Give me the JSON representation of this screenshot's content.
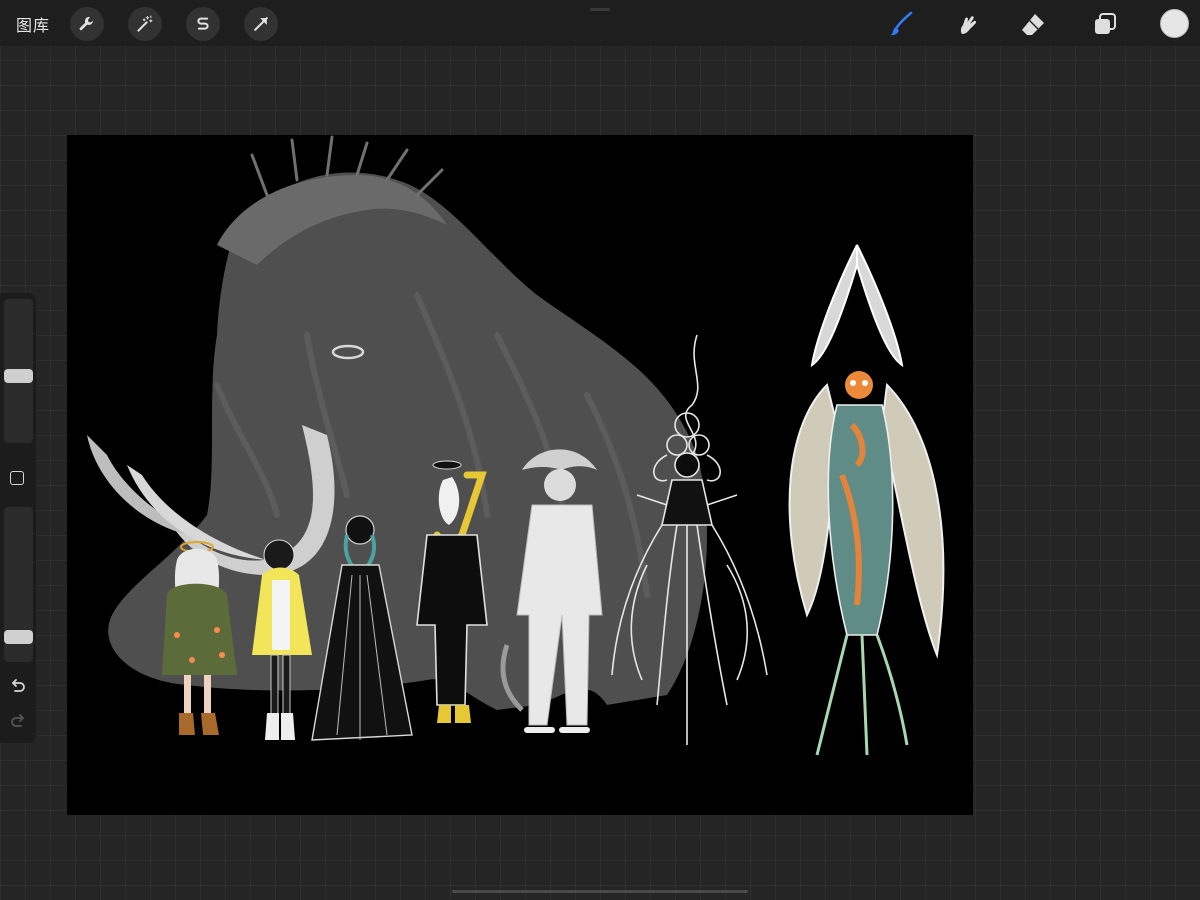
{
  "app": {
    "gallery_label": "图库"
  },
  "toolbar": {
    "left_tools": [
      {
        "name": "actions",
        "icon": "wrench-icon"
      },
      {
        "name": "adjustments",
        "icon": "magic-wand-icon"
      },
      {
        "name": "selection",
        "icon": "selection-s-icon"
      },
      {
        "name": "transform",
        "icon": "arrow-cursor-icon"
      }
    ],
    "right_tools": [
      {
        "name": "brush",
        "icon": "brush-icon",
        "active": true
      },
      {
        "name": "smudge",
        "icon": "smudge-icon",
        "active": false
      },
      {
        "name": "eraser",
        "icon": "eraser-icon",
        "active": false
      },
      {
        "name": "layers",
        "icon": "layers-icon",
        "active": false
      }
    ],
    "active_color": "#e6e6e6",
    "accent_color": "#2f7bf5"
  },
  "sidebar": {
    "brush_size_level": 0.46,
    "opacity_level": 0.13,
    "modify_icon": "square-modify-icon",
    "undo_icon": "undo-icon",
    "redo_icon": "redo-icon"
  },
  "canvas": {
    "background_color": "#000000",
    "artwork": "mammoth-and-characters-lineup"
  }
}
